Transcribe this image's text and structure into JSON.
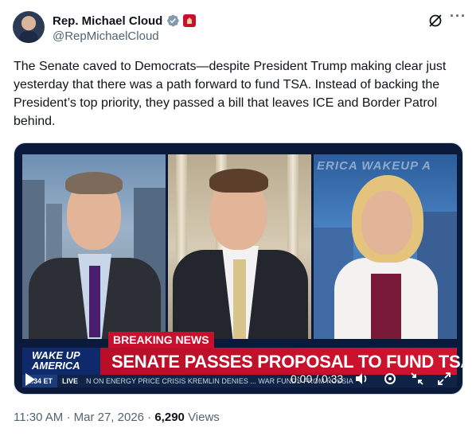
{
  "author": {
    "display_name": "Rep. Michael Cloud",
    "handle": "@RepMichaelCloud"
  },
  "tweet": {
    "text": "The Senate caved to Democrats—despite President Trump making clear just yesterday that there was a path forward to fund TSA. Instead of backing the President’s top priority, they passed a bill that leaves ICE and Border Patrol behind."
  },
  "video": {
    "overlay_brand": "ERICA WAKEUP A",
    "breaking_label": "BREAKING NEWS",
    "logo_line1": "WAKE UP",
    "logo_line2": "AMERICA",
    "headline": "SENATE PASSES PROPOSAL TO FUND TSA",
    "crawl_time": "8:34 ET",
    "crawl_live": "LIVE",
    "crawl_text": "N ON ENERGY PRICE CRISIS   KREMLIN DENIES ... WAR FUNDS FROM RUSSIA",
    "timecode": "0:00 / 0:33"
  },
  "meta": {
    "time": "11:30 AM",
    "separator": "·",
    "date": "Mar 27, 2026",
    "views_count": "6,290",
    "views_label": "Views"
  },
  "colors": {
    "verified": "#829aab",
    "breaking_red": "#c8102e",
    "fox_navy": "#0e2a6b"
  },
  "icons": [
    "verified-badge-icon",
    "house-affiliation-icon",
    "grok-icon",
    "more-icon",
    "play-icon",
    "volume-icon",
    "settings-icon",
    "fullscreen-icon"
  ]
}
